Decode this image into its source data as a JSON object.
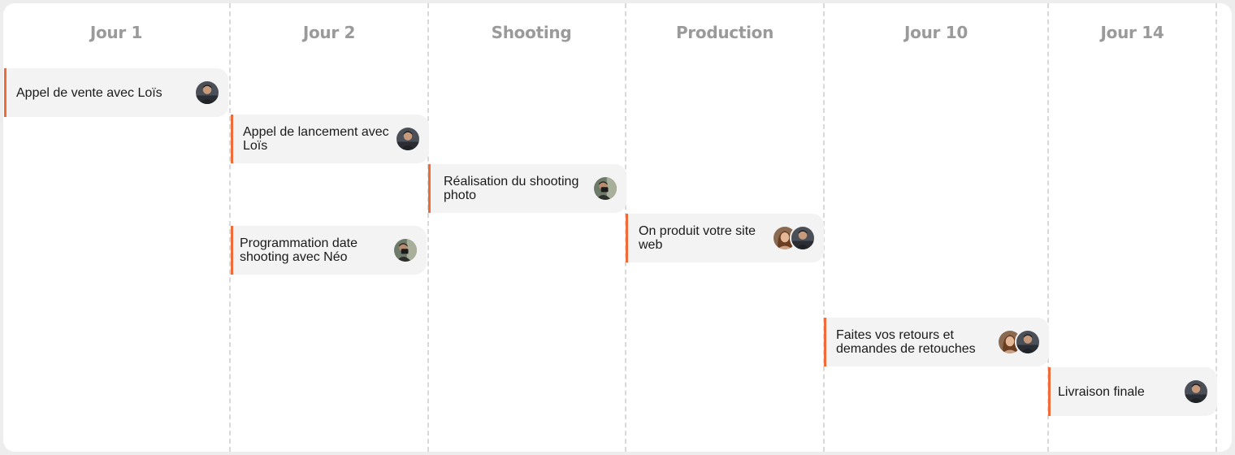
{
  "columns": [
    {
      "title": "Jour 1"
    },
    {
      "title": "Jour 2"
    },
    {
      "title": "Shooting"
    },
    {
      "title": "Production"
    },
    {
      "title": "Jour 10"
    },
    {
      "title": "Jour 14"
    }
  ],
  "tasks": [
    {
      "label": "Appel de vente avec Loïs",
      "avatars": [
        "man-avatar"
      ]
    },
    {
      "label": "Appel de lancement avec Loïs",
      "avatars": [
        "man-avatar"
      ]
    },
    {
      "label": "Programmation date shooting avec Néo",
      "avatars": [
        "photographer-avatar"
      ]
    },
    {
      "label": "Réalisation du shooting photo",
      "avatars": [
        "photographer-avatar"
      ]
    },
    {
      "label": "On produit votre site web",
      "avatars": [
        "woman-avatar",
        "man-avatar"
      ]
    },
    {
      "label": "Faites vos retours et demandes de retouches",
      "avatars": [
        "woman-avatar",
        "man-avatar"
      ]
    },
    {
      "label": "Livraison finale",
      "avatars": [
        "man-avatar"
      ]
    }
  ],
  "colors": {
    "accent": "#ef6c3a",
    "card": "#f3f3f3",
    "header_text": "#9a9a9a",
    "divider": "#d9d9d9"
  }
}
